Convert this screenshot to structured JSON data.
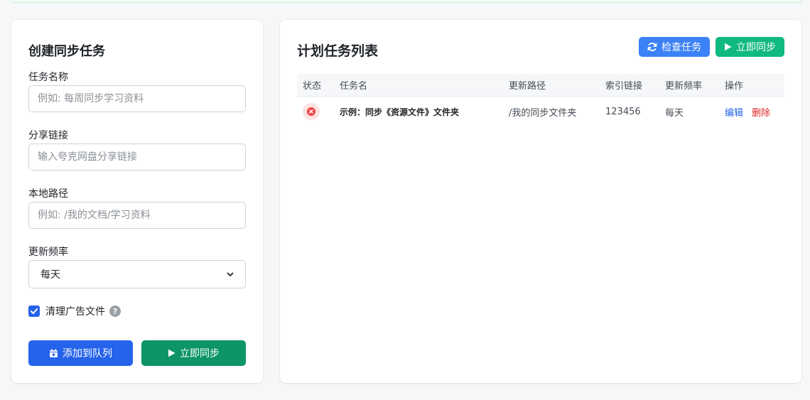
{
  "form": {
    "title": "创建同步任务",
    "task_name": {
      "label": "任务名称",
      "placeholder": "例如: 每周同步学习资料",
      "value": ""
    },
    "share_link": {
      "label": "分享链接",
      "placeholder": "输入夸克网盘分享链接",
      "value": ""
    },
    "local_path": {
      "label": "本地路径",
      "placeholder": "例如: /我的文档/学习资料",
      "value": ""
    },
    "frequency": {
      "label": "更新频率",
      "selected": "每天"
    },
    "clean_ads": {
      "label": "清理广告文件",
      "checked": true,
      "help": "?"
    },
    "add_button": "添加到队列",
    "sync_button": "立即同步"
  },
  "task_list": {
    "title": "计划任务列表",
    "check_button": "检查任务",
    "sync_button": "立即同步",
    "columns": [
      "状态",
      "任务名",
      "更新路径",
      "索引链接",
      "更新频率",
      "操作"
    ],
    "rows": [
      {
        "status": "error",
        "name": "示例：同步《资源文件》文件夹",
        "path": "/我的同步文件夹",
        "index_link": "123456",
        "frequency": "每天",
        "edit": "编辑",
        "delete": "删除"
      }
    ]
  },
  "colors": {
    "primary": "#2563eb",
    "success": "#0d9468",
    "danger": "#dc2626",
    "check_button": "#3b82f6",
    "sync_now_button": "#10b981"
  }
}
